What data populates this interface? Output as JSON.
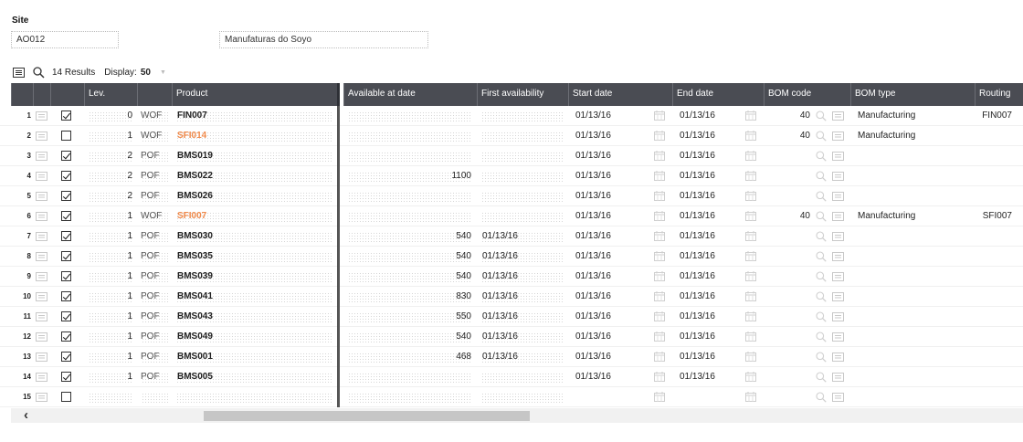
{
  "site": {
    "label": "Site",
    "code": "AO012",
    "name": "Manufaturas do Soyo"
  },
  "toolbar": {
    "results": "14 Results",
    "display_label": "Display:",
    "display_value": "50"
  },
  "columns": {
    "lev": "Lev.",
    "product": "Product",
    "available": "Available at date",
    "first": "First availability",
    "start": "Start date",
    "end": "End date",
    "bom_code": "BOM code",
    "bom_type": "BOM type",
    "routing": "Routing"
  },
  "colors": {
    "header_bg": "#4a4c53",
    "accent_orange": "#f08a4b"
  },
  "rows": [
    {
      "n": "1",
      "checked": true,
      "lev": "0",
      "src": "WOF",
      "product": "FIN007",
      "orange": false,
      "available": "",
      "first": "",
      "start": "01/13/16",
      "end": "01/13/16",
      "bom_code": "40",
      "bom_type": "Manufacturing",
      "routing": "FIN007"
    },
    {
      "n": "2",
      "checked": false,
      "lev": "1",
      "src": "WOF",
      "product": "SFI014",
      "orange": true,
      "available": "",
      "first": "",
      "start": "01/13/16",
      "end": "01/13/16",
      "bom_code": "40",
      "bom_type": "Manufacturing",
      "routing": ""
    },
    {
      "n": "3",
      "checked": true,
      "lev": "2",
      "src": "POF",
      "product": "BMS019",
      "orange": false,
      "available": "",
      "first": "",
      "start": "01/13/16",
      "end": "01/13/16",
      "bom_code": "",
      "bom_type": "",
      "routing": ""
    },
    {
      "n": "4",
      "checked": true,
      "lev": "2",
      "src": "POF",
      "product": "BMS022",
      "orange": false,
      "available": "1100",
      "first": "",
      "start": "01/13/16",
      "end": "01/13/16",
      "bom_code": "",
      "bom_type": "",
      "routing": ""
    },
    {
      "n": "5",
      "checked": true,
      "lev": "2",
      "src": "POF",
      "product": "BMS026",
      "orange": false,
      "available": "",
      "first": "",
      "start": "01/13/16",
      "end": "01/13/16",
      "bom_code": "",
      "bom_type": "",
      "routing": ""
    },
    {
      "n": "6",
      "checked": true,
      "lev": "1",
      "src": "WOF",
      "product": "SFI007",
      "orange": true,
      "available": "",
      "first": "",
      "start": "01/13/16",
      "end": "01/13/16",
      "bom_code": "40",
      "bom_type": "Manufacturing",
      "routing": "SFI007"
    },
    {
      "n": "7",
      "checked": true,
      "lev": "1",
      "src": "POF",
      "product": "BMS030",
      "orange": false,
      "available": "540",
      "first": "01/13/16",
      "start": "01/13/16",
      "end": "01/13/16",
      "bom_code": "",
      "bom_type": "",
      "routing": ""
    },
    {
      "n": "8",
      "checked": true,
      "lev": "1",
      "src": "POF",
      "product": "BMS035",
      "orange": false,
      "available": "540",
      "first": "01/13/16",
      "start": "01/13/16",
      "end": "01/13/16",
      "bom_code": "",
      "bom_type": "",
      "routing": ""
    },
    {
      "n": "9",
      "checked": true,
      "lev": "1",
      "src": "POF",
      "product": "BMS039",
      "orange": false,
      "available": "540",
      "first": "01/13/16",
      "start": "01/13/16",
      "end": "01/13/16",
      "bom_code": "",
      "bom_type": "",
      "routing": ""
    },
    {
      "n": "10",
      "checked": true,
      "lev": "1",
      "src": "POF",
      "product": "BMS041",
      "orange": false,
      "available": "830",
      "first": "01/13/16",
      "start": "01/13/16",
      "end": "01/13/16",
      "bom_code": "",
      "bom_type": "",
      "routing": ""
    },
    {
      "n": "11",
      "checked": true,
      "lev": "1",
      "src": "POF",
      "product": "BMS043",
      "orange": false,
      "available": "550",
      "first": "01/13/16",
      "start": "01/13/16",
      "end": "01/13/16",
      "bom_code": "",
      "bom_type": "",
      "routing": ""
    },
    {
      "n": "12",
      "checked": true,
      "lev": "1",
      "src": "POF",
      "product": "BMS049",
      "orange": false,
      "available": "540",
      "first": "01/13/16",
      "start": "01/13/16",
      "end": "01/13/16",
      "bom_code": "",
      "bom_type": "",
      "routing": ""
    },
    {
      "n": "13",
      "checked": true,
      "lev": "1",
      "src": "POF",
      "product": "BMS001",
      "orange": false,
      "available": "468",
      "first": "01/13/16",
      "start": "01/13/16",
      "end": "01/13/16",
      "bom_code": "",
      "bom_type": "",
      "routing": ""
    },
    {
      "n": "14",
      "checked": true,
      "lev": "1",
      "src": "POF",
      "product": "BMS005",
      "orange": false,
      "available": "",
      "first": "",
      "start": "01/13/16",
      "end": "01/13/16",
      "bom_code": "",
      "bom_type": "",
      "routing": ""
    },
    {
      "n": "15",
      "checked": false,
      "lev": "",
      "src": "",
      "product": "",
      "orange": false,
      "available": "",
      "first": "",
      "start": "",
      "end": "",
      "bom_code": "",
      "bom_type": "",
      "routing": ""
    }
  ]
}
